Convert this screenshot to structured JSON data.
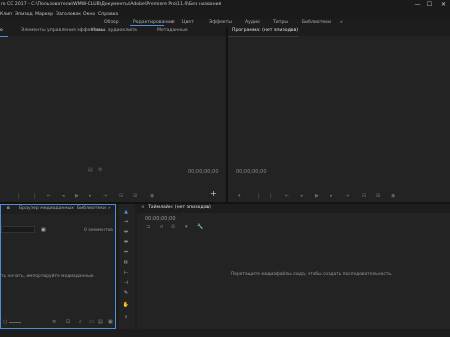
{
  "window": {
    "title": "ro CC 2017 - C:\\Пользователи\\WMW-CLUB\\Документы\\Adobe\\Premiere Pro\\11.0\\Без названия",
    "minimize_glyph": "—",
    "maximize_glyph": "☐",
    "close_glyph": "✕"
  },
  "menu": [
    "Клип",
    "Эпизод",
    "Маркер",
    "Заголовок",
    "Окно",
    "Справка"
  ],
  "workspaces": {
    "items": [
      "Обзор",
      "Редактирование",
      "Цвет",
      "Эффекты",
      "Аудио",
      "Титры",
      "Библиотеки"
    ],
    "active": "Редактирование",
    "active_menu_glyph": "≡",
    "overflow_glyph": "»"
  },
  "source_panel": {
    "tabs": [
      "о",
      "Элементы управления эффектами",
      "Микш. аудиоклипа",
      "Метаданные"
    ],
    "timecode": "00;00;00;00",
    "add_glyph": "+"
  },
  "program_panel": {
    "tab": "Программа: (нет эпизодов)",
    "menu_glyph": "≡",
    "timecode": "00;00;00;00"
  },
  "project_panel": {
    "tabs": [
      "в",
      "Браузер медиаданных",
      "Библиотеки"
    ],
    "overflow_glyph": "»",
    "items_count": "0 элементов",
    "empty_text": "ть начать, импортируйте медиаданные."
  },
  "timeline_panel": {
    "close_glyph": "×",
    "tab": "Таймлайн: (нет эпизодов)",
    "menu_glyph": "≡",
    "timecode": "00;00;00;00",
    "empty_text": "Перетащите медиафайлы сюда, чтобы создать последовательность."
  },
  "colors": {
    "accent": "#4f8edc",
    "panel_bg": "#232323",
    "bar_bg": "#1a1a1a"
  }
}
